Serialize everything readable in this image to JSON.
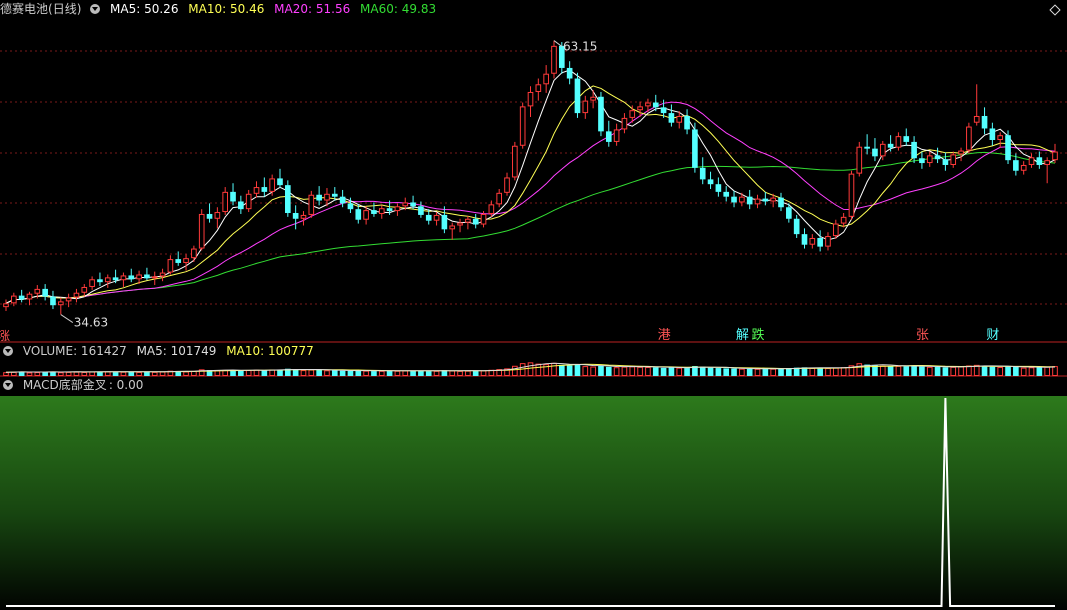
{
  "stock": {
    "name": "德赛电池",
    "period": "(日线)",
    "ma5": "MA5: 50.26",
    "ma10": "MA10: 50.46",
    "ma20": "MA20: 51.56",
    "ma60": "MA60: 49.83"
  },
  "volume_legend": {
    "volume": "VOLUME: 161427",
    "ma5": "MA5: 101749",
    "ma10": "MA10: 100777"
  },
  "macd_legend": {
    "name": "MACD底部金叉",
    "value": ": 0.00"
  },
  "colors": {
    "up": "#ff3a3a",
    "down": "#54ffff",
    "ma5": "#ffffff",
    "ma10": "#ffff55",
    "ma20": "#ff40ff",
    "ma60": "#33dd33",
    "macd_line": "#ffffff"
  },
  "chart_data": {
    "type": "candlestick",
    "title": "德赛电池(日线)",
    "high_label": "63.15",
    "low_label": "34.63",
    "ylim": [
      32.5,
      65.5
    ],
    "ohlc": [
      [
        35.4,
        36.2,
        35.0,
        35.8
      ],
      [
        35.8,
        36.9,
        35.5,
        36.6
      ],
      [
        36.6,
        37.2,
        35.9,
        36.2
      ],
      [
        36.2,
        37.0,
        35.6,
        36.8
      ],
      [
        36.8,
        37.7,
        36.3,
        37.3
      ],
      [
        37.3,
        37.8,
        36.1,
        36.5
      ],
      [
        36.5,
        37.1,
        35.2,
        35.6
      ],
      [
        35.6,
        36.4,
        34.63,
        36.0
      ],
      [
        36.0,
        36.8,
        35.4,
        36.4
      ],
      [
        36.4,
        37.3,
        35.9,
        36.9
      ],
      [
        36.9,
        37.8,
        36.5,
        37.5
      ],
      [
        37.5,
        38.6,
        37.2,
        38.3
      ],
      [
        38.3,
        39.0,
        37.6,
        38.0
      ],
      [
        38.0,
        38.8,
        37.4,
        38.5
      ],
      [
        38.5,
        39.3,
        37.9,
        38.2
      ],
      [
        38.2,
        39.0,
        37.5,
        38.7
      ],
      [
        38.7,
        39.4,
        38.0,
        38.3
      ],
      [
        38.3,
        39.2,
        37.8,
        38.8
      ],
      [
        38.8,
        39.5,
        38.2,
        38.4
      ],
      [
        38.4,
        39.1,
        37.7,
        38.6
      ],
      [
        38.6,
        39.4,
        38.1,
        39.0
      ],
      [
        39.0,
        40.8,
        38.8,
        40.4
      ],
      [
        40.4,
        41.2,
        39.7,
        40.0
      ],
      [
        40.0,
        40.9,
        39.2,
        40.5
      ],
      [
        40.5,
        41.8,
        40.1,
        41.5
      ],
      [
        41.5,
        45.6,
        41.3,
        45.1
      ],
      [
        45.1,
        46.2,
        44.2,
        44.6
      ],
      [
        44.6,
        45.8,
        43.6,
        45.3
      ],
      [
        45.3,
        47.9,
        45.0,
        47.4
      ],
      [
        47.4,
        48.3,
        46.0,
        46.4
      ],
      [
        46.4,
        47.0,
        45.1,
        45.6
      ],
      [
        45.6,
        47.6,
        45.3,
        47.2
      ],
      [
        47.2,
        48.5,
        46.8,
        47.9
      ],
      [
        47.9,
        48.9,
        46.9,
        47.4
      ],
      [
        47.4,
        49.2,
        47.0,
        48.8
      ],
      [
        48.8,
        49.8,
        47.8,
        48.1
      ],
      [
        48.1,
        48.6,
        44.8,
        45.2
      ],
      [
        45.2,
        46.0,
        43.5,
        44.6
      ],
      [
        44.6,
        45.4,
        43.9,
        45.0
      ],
      [
        45.0,
        47.5,
        44.7,
        47.1
      ],
      [
        47.1,
        48.0,
        46.0,
        46.5
      ],
      [
        46.5,
        47.8,
        45.9,
        47.2
      ],
      [
        47.2,
        47.9,
        46.5,
        46.9
      ],
      [
        46.9,
        47.6,
        45.8,
        46.2
      ],
      [
        46.2,
        46.8,
        45.2,
        45.6
      ],
      [
        45.6,
        46.1,
        44.1,
        44.5
      ],
      [
        44.5,
        45.9,
        44.0,
        45.5
      ],
      [
        45.5,
        46.3,
        44.8,
        45.1
      ],
      [
        45.1,
        46.0,
        44.6,
        45.7
      ],
      [
        45.7,
        46.5,
        45.0,
        45.4
      ],
      [
        45.4,
        46.2,
        44.9,
        45.9
      ],
      [
        45.9,
        46.8,
        45.5,
        46.3
      ],
      [
        46.3,
        47.0,
        45.6,
        45.9
      ],
      [
        45.9,
        46.4,
        44.7,
        45.0
      ],
      [
        45.0,
        45.6,
        44.0,
        44.4
      ],
      [
        44.4,
        45.3,
        43.9,
        45.0
      ],
      [
        45.0,
        45.9,
        43.1,
        43.5
      ],
      [
        43.5,
        44.2,
        42.4,
        43.9
      ],
      [
        43.9,
        44.6,
        43.2,
        44.2
      ],
      [
        44.2,
        44.9,
        43.5,
        44.6
      ],
      [
        44.6,
        45.1,
        43.6,
        44.0
      ],
      [
        44.0,
        45.4,
        43.7,
        45.1
      ],
      [
        45.1,
        46.5,
        44.8,
        46.1
      ],
      [
        46.1,
        47.7,
        45.8,
        47.3
      ],
      [
        47.3,
        49.4,
        47.0,
        48.9
      ],
      [
        48.9,
        52.6,
        48.6,
        52.2
      ],
      [
        52.2,
        56.7,
        51.9,
        56.3
      ],
      [
        56.3,
        58.4,
        55.2,
        57.8
      ],
      [
        57.8,
        59.2,
        56.9,
        58.6
      ],
      [
        58.6,
        60.6,
        57.7,
        59.7
      ],
      [
        59.7,
        63.15,
        59.2,
        62.6
      ],
      [
        62.6,
        63.0,
        59.7,
        60.3
      ],
      [
        60.3,
        61.0,
        58.6,
        59.2
      ],
      [
        59.2,
        59.8,
        55.1,
        55.6
      ],
      [
        55.6,
        57.4,
        55.0,
        56.9
      ],
      [
        56.9,
        58.0,
        56.1,
        57.3
      ],
      [
        57.3,
        57.8,
        53.2,
        53.7
      ],
      [
        53.7,
        54.8,
        52.1,
        52.6
      ],
      [
        52.6,
        54.5,
        52.2,
        53.9
      ],
      [
        53.9,
        55.6,
        53.5,
        55.1
      ],
      [
        55.1,
        56.4,
        54.6,
        55.9
      ],
      [
        55.9,
        56.8,
        55.2,
        56.3
      ],
      [
        56.3,
        57.1,
        55.7,
        56.7
      ],
      [
        56.7,
        57.5,
        55.8,
        56.2
      ],
      [
        56.2,
        57.0,
        55.1,
        55.6
      ],
      [
        55.6,
        56.5,
        54.2,
        54.6
      ],
      [
        54.6,
        55.8,
        54.0,
        55.3
      ],
      [
        55.3,
        56.0,
        53.4,
        53.9
      ],
      [
        53.9,
        54.6,
        49.4,
        49.9
      ],
      [
        49.9,
        51.0,
        48.2,
        48.7
      ],
      [
        48.7,
        49.5,
        47.7,
        48.2
      ],
      [
        48.2,
        48.9,
        46.9,
        47.4
      ],
      [
        47.4,
        48.0,
        46.4,
        46.9
      ],
      [
        46.9,
        47.5,
        45.8,
        46.3
      ],
      [
        46.3,
        47.3,
        45.9,
        46.9
      ],
      [
        46.9,
        47.6,
        45.6,
        46.1
      ],
      [
        46.1,
        47.1,
        45.7,
        46.7
      ],
      [
        46.7,
        47.4,
        46.0,
        46.4
      ],
      [
        46.4,
        47.2,
        45.8,
        46.8
      ],
      [
        46.8,
        47.3,
        45.4,
        45.8
      ],
      [
        45.8,
        46.2,
        44.2,
        44.6
      ],
      [
        44.6,
        45.0,
        42.6,
        43.0
      ],
      [
        43.0,
        43.6,
        41.5,
        41.9
      ],
      [
        41.9,
        43.0,
        41.5,
        42.6
      ],
      [
        42.6,
        43.4,
        41.2,
        41.7
      ],
      [
        41.7,
        43.2,
        41.3,
        42.8
      ],
      [
        42.8,
        44.5,
        42.5,
        44.1
      ],
      [
        44.1,
        45.2,
        43.7,
        44.8
      ],
      [
        44.8,
        49.6,
        44.5,
        49.3
      ],
      [
        49.3,
        52.6,
        49.0,
        52.1
      ],
      [
        52.1,
        53.4,
        51.3,
        51.9
      ],
      [
        51.9,
        53.0,
        50.6,
        51.1
      ],
      [
        51.1,
        52.7,
        50.7,
        52.4
      ],
      [
        52.4,
        53.3,
        51.6,
        52.0
      ],
      [
        52.0,
        53.6,
        51.7,
        53.2
      ],
      [
        53.2,
        54.0,
        52.2,
        52.6
      ],
      [
        52.6,
        53.2,
        50.4,
        50.9
      ],
      [
        50.9,
        51.6,
        49.8,
        50.4
      ],
      [
        50.4,
        51.6,
        50.0,
        51.2
      ],
      [
        51.2,
        52.0,
        50.4,
        50.8
      ],
      [
        50.8,
        51.5,
        49.6,
        50.2
      ],
      [
        50.2,
        51.6,
        49.9,
        51.3
      ],
      [
        51.3,
        52.0,
        50.6,
        51.7
      ],
      [
        51.7,
        54.6,
        51.4,
        54.2
      ],
      [
        54.6,
        58.6,
        54.3,
        55.3
      ],
      [
        55.3,
        56.2,
        53.4,
        54.0
      ],
      [
        54.0,
        54.6,
        52.2,
        52.8
      ],
      [
        52.8,
        53.6,
        52.0,
        53.3
      ],
      [
        53.3,
        53.8,
        50.3,
        50.7
      ],
      [
        50.7,
        51.4,
        49.1,
        49.6
      ],
      [
        49.6,
        50.6,
        49.2,
        50.2
      ],
      [
        50.2,
        51.4,
        49.9,
        51.0
      ],
      [
        51.0,
        51.6,
        49.8,
        50.2
      ],
      [
        50.2,
        51.0,
        48.3,
        50.7
      ],
      [
        50.7,
        52.4,
        50.4,
        51.6
      ]
    ],
    "volume": [
      62,
      66,
      71,
      58,
      64,
      69,
      73,
      61,
      67,
      70,
      65,
      72,
      68,
      74,
      63,
      69,
      71,
      66,
      70,
      67,
      72,
      86,
      79,
      74,
      83,
      108,
      96,
      91,
      99,
      94,
      84,
      97,
      102,
      93,
      106,
      101,
      118,
      111,
      96,
      104,
      99,
      93,
      89,
      86,
      83,
      91,
      87,
      80,
      84,
      88,
      85,
      90,
      86,
      81,
      79,
      84,
      95,
      89,
      83,
      86,
      82,
      92,
      101,
      112,
      124,
      166,
      209,
      222,
      201,
      193,
      214,
      181,
      172,
      186,
      161,
      154,
      168,
      149,
      143,
      152,
      157,
      149,
      146,
      139,
      132,
      141,
      136,
      129,
      162,
      152,
      136,
      129,
      124,
      121,
      119,
      114,
      117,
      113,
      119,
      121,
      129,
      136,
      141,
      131,
      126,
      129,
      136,
      144,
      174,
      208,
      186,
      172,
      166,
      159,
      164,
      157,
      169,
      153,
      149,
      146,
      141,
      149,
      156,
      171,
      181,
      164,
      151,
      146,
      159,
      147,
      136,
      142,
      139,
      152,
      161
    ],
    "volume_ylim": [
      0,
      260
    ],
    "macd_signal_index": 120,
    "markers": [
      {
        "label": "港",
        "index": 84,
        "color": "#ff5555"
      },
      {
        "label": "解",
        "index": 94,
        "color": "#55ffff"
      },
      {
        "label": "跌",
        "index": 96,
        "color": "#55ff55"
      },
      {
        "label": "张",
        "index": 117,
        "color": "#ff5555"
      },
      {
        "label": "财",
        "index": 126,
        "color": "#55ffff"
      }
    ]
  }
}
